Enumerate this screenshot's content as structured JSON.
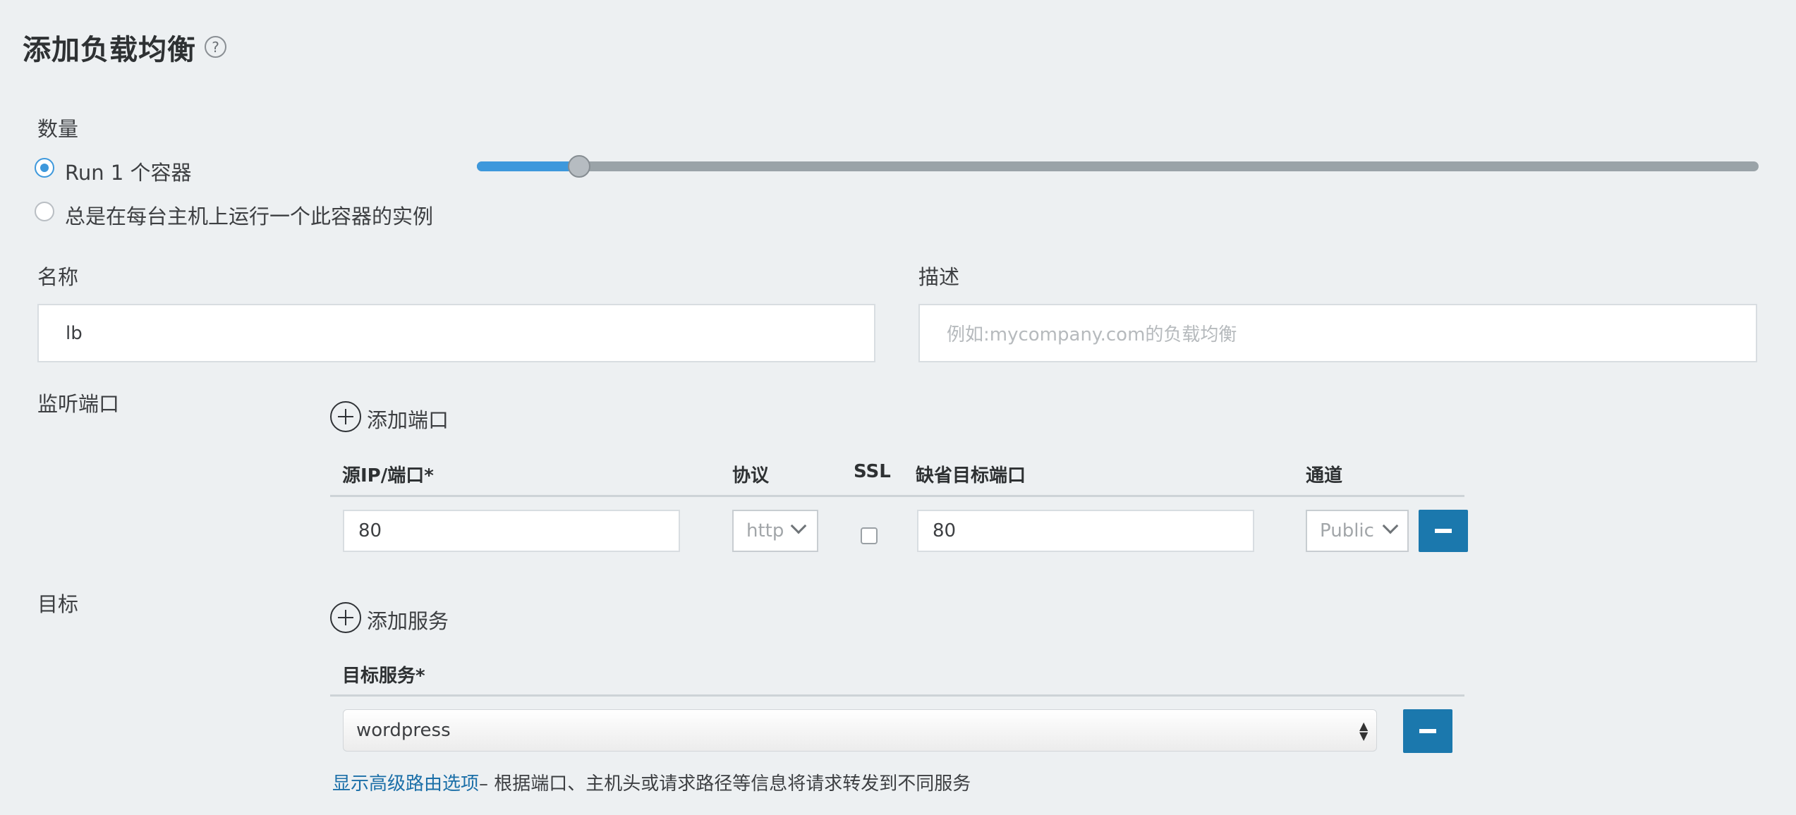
{
  "header": {
    "title": "添加负载均衡",
    "help_icon": "?"
  },
  "scale": {
    "label": "数量",
    "options": [
      {
        "label": "Run 1 个容器",
        "checked": true
      },
      {
        "label": "总是在每台主机上运行一个此容器的实例",
        "checked": false
      }
    ],
    "slider_fraction": 0.08
  },
  "name": {
    "label": "名称",
    "value": "lb"
  },
  "description": {
    "label": "描述",
    "placeholder": "例如:mycompany.com的负载均衡"
  },
  "ports": {
    "label": "监听端口",
    "add_label": "添加端口",
    "headers": {
      "source": "源IP/端口*",
      "protocol": "协议",
      "ssl": "SSL",
      "target": "缺省目标端口",
      "channel": "通道"
    },
    "rows": [
      {
        "source": "80",
        "protocol": "http",
        "ssl": false,
        "target": "80",
        "channel": "Public"
      }
    ]
  },
  "targets": {
    "label": "目标",
    "add_label": "添加服务",
    "header": "目标服务*",
    "rows": [
      {
        "service": "wordpress"
      }
    ]
  },
  "advanced": {
    "link": "显示高级路由选项",
    "note": "– 根据端口、主机头或请求路径等信息将请求转发到不同服务"
  },
  "colors": {
    "accent": "#3d98dc",
    "button": "#1b78ad",
    "link": "#1b6fa8"
  }
}
